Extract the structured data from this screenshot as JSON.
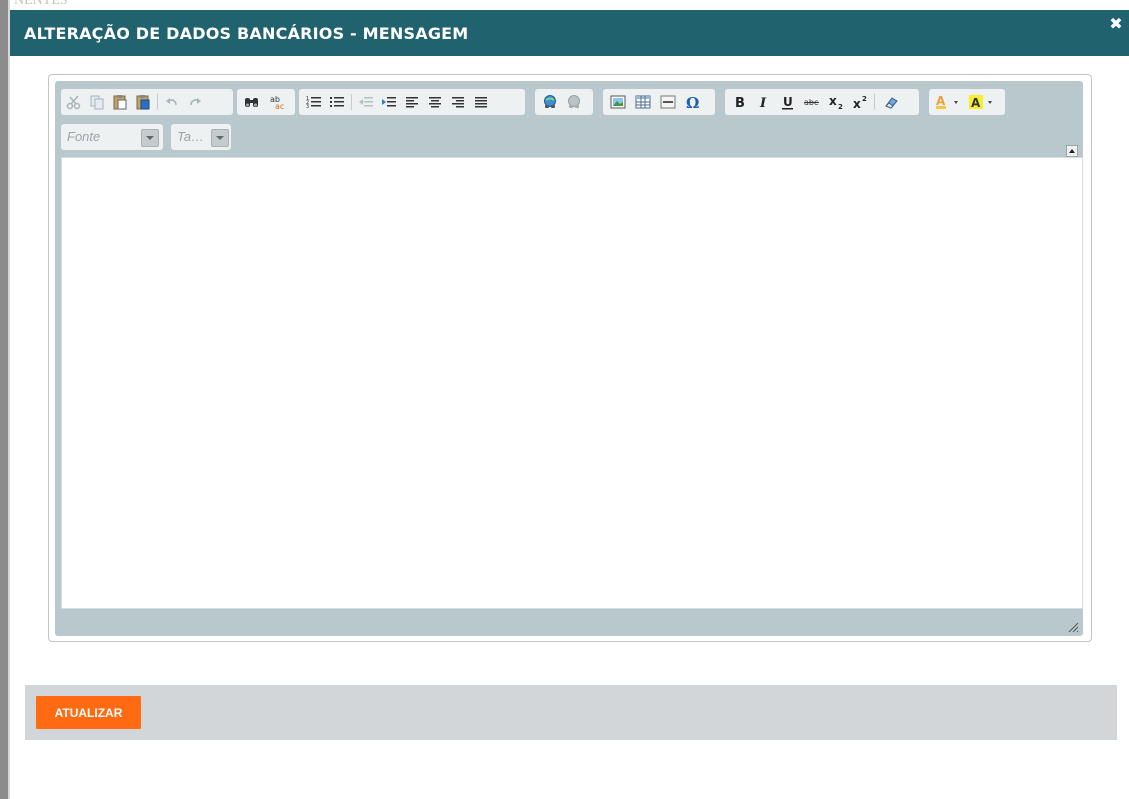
{
  "header": {
    "title": "ALTERAÇÃO DE DADOS BANCÁRIOS - MENSAGEM",
    "close_icon": "close-icon"
  },
  "background": {
    "ghost_text": "NENTES"
  },
  "editor": {
    "font_combo": {
      "label": "Fonte"
    },
    "size_combo": {
      "label": "Ta…"
    },
    "content": ""
  },
  "footer": {
    "submit_label": "ATUALIZAR"
  },
  "colors": {
    "header_bg": "#21626f",
    "accent": "#ff6a13",
    "toolbar_bg": "#b9c8cd",
    "footer_bg": "#d3d6d8"
  }
}
